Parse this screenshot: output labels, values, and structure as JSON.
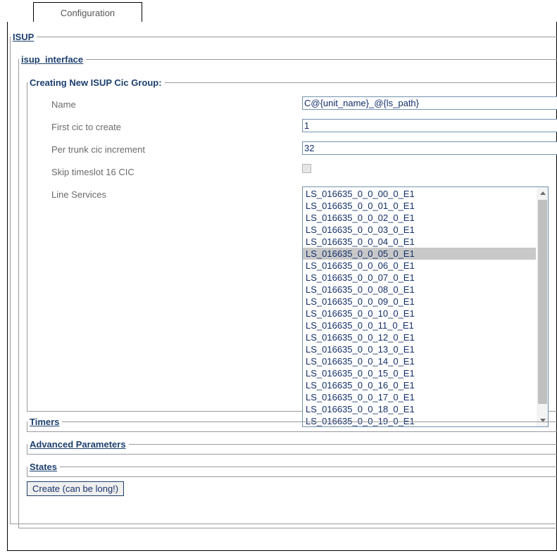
{
  "tab": {
    "label": "Configuration"
  },
  "sections": {
    "isup": {
      "legend": "ISUP"
    },
    "isup_interface": {
      "legend": "isup_interface"
    },
    "creating": {
      "legend": "Creating New ISUP Cic Group:"
    },
    "timers": {
      "legend": "Timers"
    },
    "advanced": {
      "legend": "Advanced Parameters"
    },
    "states": {
      "legend": "States"
    }
  },
  "form": {
    "name": {
      "label": "Name",
      "value": "C@{unit_name}_@{ls_path}",
      "placeholder": ""
    },
    "first_cic": {
      "label": "First cic to create",
      "value": "1",
      "placeholder": ""
    },
    "increment": {
      "label": "Per trunk cic increment",
      "value": "32",
      "placeholder": ""
    },
    "skip_ts16": {
      "label": "Skip timeslot 16 CIC",
      "checked": false
    },
    "line_services": {
      "label": "Line Services",
      "selected": "LS_016635_0_0_05_0_E1",
      "items": [
        "LS_016635_0_0_00_0_E1",
        "LS_016635_0_0_01_0_E1",
        "LS_016635_0_0_02_0_E1",
        "LS_016635_0_0_03_0_E1",
        "LS_016635_0_0_04_0_E1",
        "LS_016635_0_0_05_0_E1",
        "LS_016635_0_0_06_0_E1",
        "LS_016635_0_0_07_0_E1",
        "LS_016635_0_0_08_0_E1",
        "LS_016635_0_0_09_0_E1",
        "LS_016635_0_0_10_0_E1",
        "LS_016635_0_0_11_0_E1",
        "LS_016635_0_0_12_0_E1",
        "LS_016635_0_0_13_0_E1",
        "LS_016635_0_0_14_0_E1",
        "LS_016635_0_0_15_0_E1",
        "LS_016635_0_0_16_0_E1",
        "LS_016635_0_0_17_0_E1",
        "LS_016635_0_0_18_0_E1",
        "LS_016635_0_0_19_0_E1"
      ]
    }
  },
  "buttons": {
    "create": "Create (can be long!)"
  },
  "icons": {
    "scroll_up": "triangle-up-icon",
    "scroll_down": "triangle-down-icon"
  },
  "colors": {
    "legend": "#1c3f6e",
    "field_text": "#14306b",
    "label_text": "#6b6b6b",
    "input_border": "#7391ac",
    "selection_bg": "#c8c8c8",
    "frame": "#000000",
    "fieldset_border": "#9a9a9a"
  }
}
